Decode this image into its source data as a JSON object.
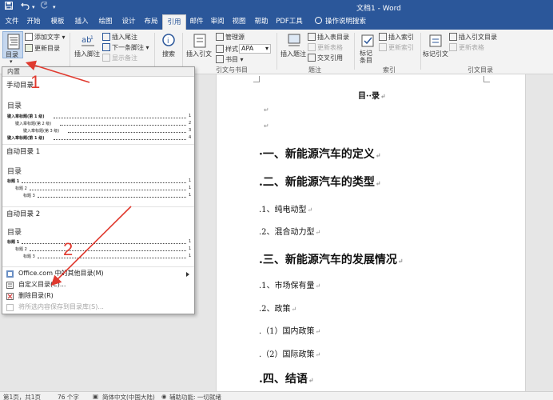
{
  "titlebar": {
    "title": "文档1 - Word",
    "quick_access": [
      "save-icon",
      "undo-icon",
      "redo-icon",
      "customize-icon"
    ]
  },
  "tabs": [
    {
      "label": "文件",
      "active": false
    },
    {
      "label": "开始",
      "active": false
    },
    {
      "label": "模板",
      "active": false
    },
    {
      "label": "插入",
      "active": false
    },
    {
      "label": "绘图",
      "active": false
    },
    {
      "label": "设计",
      "active": false
    },
    {
      "label": "布局",
      "active": false
    },
    {
      "label": "引用",
      "active": true
    },
    {
      "label": "邮件",
      "active": false
    },
    {
      "label": "审阅",
      "active": false
    },
    {
      "label": "视图",
      "active": false
    },
    {
      "label": "帮助",
      "active": false
    },
    {
      "label": "PDF工具",
      "active": false
    }
  ],
  "tell_me": "操作说明搜索",
  "ribbon": {
    "toc_button": "目录",
    "add_text": "添加文字",
    "update_toc": "更新目录",
    "insert_footnote": "插入脚注",
    "insert_endnote": "插入尾注",
    "next_footnote": "下一条脚注",
    "show_notes": "显示备注",
    "search": "搜索",
    "insert_citation": "插入引文",
    "manage_sources": "管理源",
    "style_label": "样式:",
    "style_value": "APA",
    "bibliography": "书目",
    "insert_caption": "插入题注",
    "insert_table_of_figures": "插入表目录",
    "update_table": "更新表格",
    "cross_reference": "交叉引用",
    "mark_entry": "标记条目",
    "insert_index": "插入索引",
    "update_index": "更新索引",
    "mark_citation": "标记引文",
    "insert_table_of_authorities": "插入引文目录",
    "update_table_auth": "更新表格",
    "groups": {
      "citations": "引文与书目",
      "captions": "题注",
      "index": "索引",
      "authorities": "引文目录"
    }
  },
  "dropdown": {
    "header": "内置",
    "manual": {
      "name": "手动目录",
      "title": "目录",
      "lines": [
        {
          "label": "键入章标题(第 1 级)",
          "num": "1",
          "level": 1
        },
        {
          "label": "键入章标题(第 2 级)",
          "num": "2",
          "level": 2
        },
        {
          "label": "键入章标题(第 3 级)",
          "num": "3",
          "level": 3
        },
        {
          "label": "键入章标题(第 1 级)",
          "num": "4",
          "level": 1
        }
      ]
    },
    "auto1": {
      "name": "自动目录 1",
      "title": "目录",
      "lines": [
        {
          "label": "标题 1",
          "num": "1",
          "level": 1
        },
        {
          "label": "标题 2",
          "num": "1",
          "level": 2
        },
        {
          "label": "标题 3",
          "num": "1",
          "level": 3
        }
      ]
    },
    "auto2": {
      "name": "自动目录 2",
      "title": "目录",
      "lines": [
        {
          "label": "标题 1",
          "num": "1",
          "level": 1
        },
        {
          "label": "标题 2",
          "num": "1",
          "level": 2
        },
        {
          "label": "标题 3",
          "num": "1",
          "level": 3
        }
      ]
    },
    "menu": {
      "office": "Office.com 中的其他目录(M)",
      "custom": "自定义目录(C)...",
      "remove": "删除目录(R)",
      "save": "将所选内容保存到目录库(S)..."
    }
  },
  "document": {
    "title": "目··录",
    "paragraph_mark": "↵",
    "headings": [
      {
        "text": "·一、新能源汽车的定义",
        "style": "h1"
      },
      {
        "text": ".二、新能源汽车的类型",
        "style": "h1"
      },
      {
        "text": ".1、纯电动型",
        "style": "h2"
      },
      {
        "text": ".2、混合动力型",
        "style": "h2"
      },
      {
        "text": ".三、新能源汽车的发展情况",
        "style": "h1"
      },
      {
        "text": ".1、市场保有量",
        "style": "h2"
      },
      {
        "text": ".2、政策",
        "style": "h2"
      },
      {
        "text": ".（1）国内政策",
        "style": "h2"
      },
      {
        "text": ".（2）国际政策",
        "style": "h2"
      },
      {
        "text": ".四、结语",
        "style": "h1"
      }
    ]
  },
  "annotations": [
    "1",
    "2"
  ],
  "status": {
    "page": "第1页，共1页",
    "words": "76 个字",
    "language": "简体中文(中国大陆)",
    "accessibility": "辅助功能: 一切就绪"
  },
  "colors": {
    "word_blue": "#2b579a",
    "annotation_red": "#e03a2f"
  }
}
